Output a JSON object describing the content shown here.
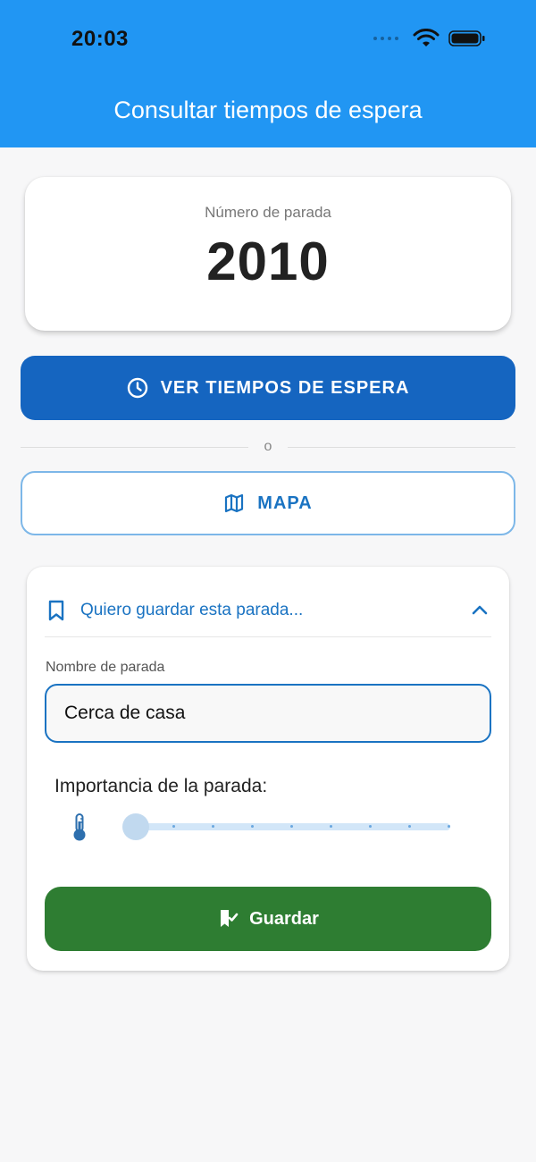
{
  "status_bar": {
    "time": "20:03"
  },
  "header": {
    "title": "Consultar tiempos de espera"
  },
  "stop": {
    "label": "Número de parada",
    "number": "2010"
  },
  "actions": {
    "wait_times_label": "VER TIEMPOS DE ESPERA",
    "divider_text": "o",
    "map_label": "MAPA"
  },
  "save_panel": {
    "title": "Quiero guardar esta parada...",
    "name_label": "Nombre de parada",
    "name_value": "Cerca de casa",
    "importance_label": "Importancia de la parada:",
    "importance_value": 0,
    "importance_steps": 8,
    "save_label": "Guardar"
  },
  "colors": {
    "header": "#2196f3",
    "primary_button": "#1565c0",
    "accent": "#1a73c2",
    "save_button": "#2e7d32"
  },
  "icons": {
    "wait_times": "clock-icon",
    "map": "map-icon",
    "save_panel": "bookmark-icon",
    "collapse": "chevron-up-icon",
    "importance": "thermometer-icon",
    "save": "bookmark-check-icon"
  }
}
